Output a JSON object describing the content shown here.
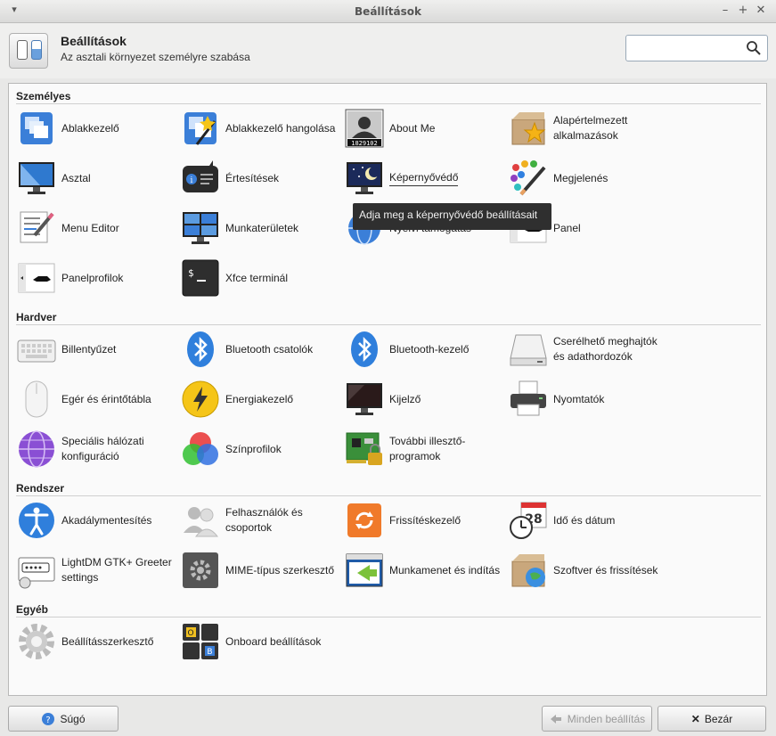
{
  "window": {
    "title": "Beállítások"
  },
  "header": {
    "title": "Beállítások",
    "subtitle": "Az asztali környezet személyre szabása",
    "search_placeholder": ""
  },
  "sections": [
    {
      "title": "Személyes",
      "items": [
        {
          "label": "Ablakkezelő",
          "icon": "window-manager-icon"
        },
        {
          "label": "Ablakkezelő hangolása",
          "icon": "window-manager-tweaks-icon"
        },
        {
          "label": "About Me",
          "icon": "about-me-icon"
        },
        {
          "label": "Alapértelmezett alkalmazások",
          "icon": "default-apps-icon"
        },
        {
          "label": "Asztal",
          "icon": "desktop-icon"
        },
        {
          "label": "Értesítések",
          "icon": "notifications-icon"
        },
        {
          "label": "Képernyővédő",
          "icon": "screensaver-icon"
        },
        {
          "label": "Megjelenés",
          "icon": "appearance-icon"
        },
        {
          "label": "Menu Editor",
          "icon": "menu-editor-icon"
        },
        {
          "label": "Munkaterületek",
          "icon": "workspaces-icon"
        },
        {
          "label": "Nyelvi támogatás",
          "icon": "language-support-icon"
        },
        {
          "label": "Panel",
          "icon": "panel-icon"
        },
        {
          "label": "Panelprofilok",
          "icon": "panel-profiles-icon"
        },
        {
          "label": "Xfce terminál",
          "icon": "terminal-icon"
        }
      ]
    },
    {
      "title": "Hardver",
      "items": [
        {
          "label": "Billentyűzet",
          "icon": "keyboard-icon"
        },
        {
          "label": "Bluetooth csatolók",
          "icon": "bluetooth-icon"
        },
        {
          "label": "Bluetooth-kezelő",
          "icon": "bluetooth-manager-icon"
        },
        {
          "label": "Cserélhető meghajtók és adathordozók",
          "icon": "removable-drives-icon"
        },
        {
          "label": "Egér és érintőtábla",
          "icon": "mouse-icon"
        },
        {
          "label": "Energiakezelő",
          "icon": "power-manager-icon"
        },
        {
          "label": "Kijelző",
          "icon": "display-icon"
        },
        {
          "label": "Nyomtatók",
          "icon": "printer-icon"
        },
        {
          "label": "Speciális hálózati konfiguráció",
          "icon": "network-icon"
        },
        {
          "label": "Színprofilok",
          "icon": "color-profiles-icon"
        },
        {
          "label": "További illesztő-programok",
          "icon": "additional-drivers-icon"
        }
      ]
    },
    {
      "title": "Rendszer",
      "items": [
        {
          "label": "Akadálymentesítés",
          "icon": "accessibility-icon"
        },
        {
          "label": "Felhasználók és csoportok",
          "icon": "users-groups-icon"
        },
        {
          "label": "Frissítéskezelő",
          "icon": "update-manager-icon"
        },
        {
          "label": "Idő és dátum",
          "icon": "time-date-icon"
        },
        {
          "label": "LightDM GTK+ Greeter settings",
          "icon": "lightdm-greeter-icon"
        },
        {
          "label": "MIME-típus szerkesztő",
          "icon": "mime-editor-icon"
        },
        {
          "label": "Munkamenet és indítás",
          "icon": "session-startup-icon"
        },
        {
          "label": "Szoftver és frissítések",
          "icon": "software-updates-icon"
        }
      ]
    },
    {
      "title": "Egyéb",
      "items": [
        {
          "label": "Beállításszerkesztő",
          "icon": "settings-editor-icon"
        },
        {
          "label": "Onboard beállítások",
          "icon": "onboard-icon"
        }
      ]
    }
  ],
  "tooltip": "Adja meg a képernyővédő beállításait",
  "footer": {
    "help_label": "Súgó",
    "all_settings_label": "Minden beállítás",
    "close_label": "Bezár"
  },
  "colors": {
    "accent": "#3d7fd1",
    "tooltip_bg": "#2f2f2f"
  }
}
